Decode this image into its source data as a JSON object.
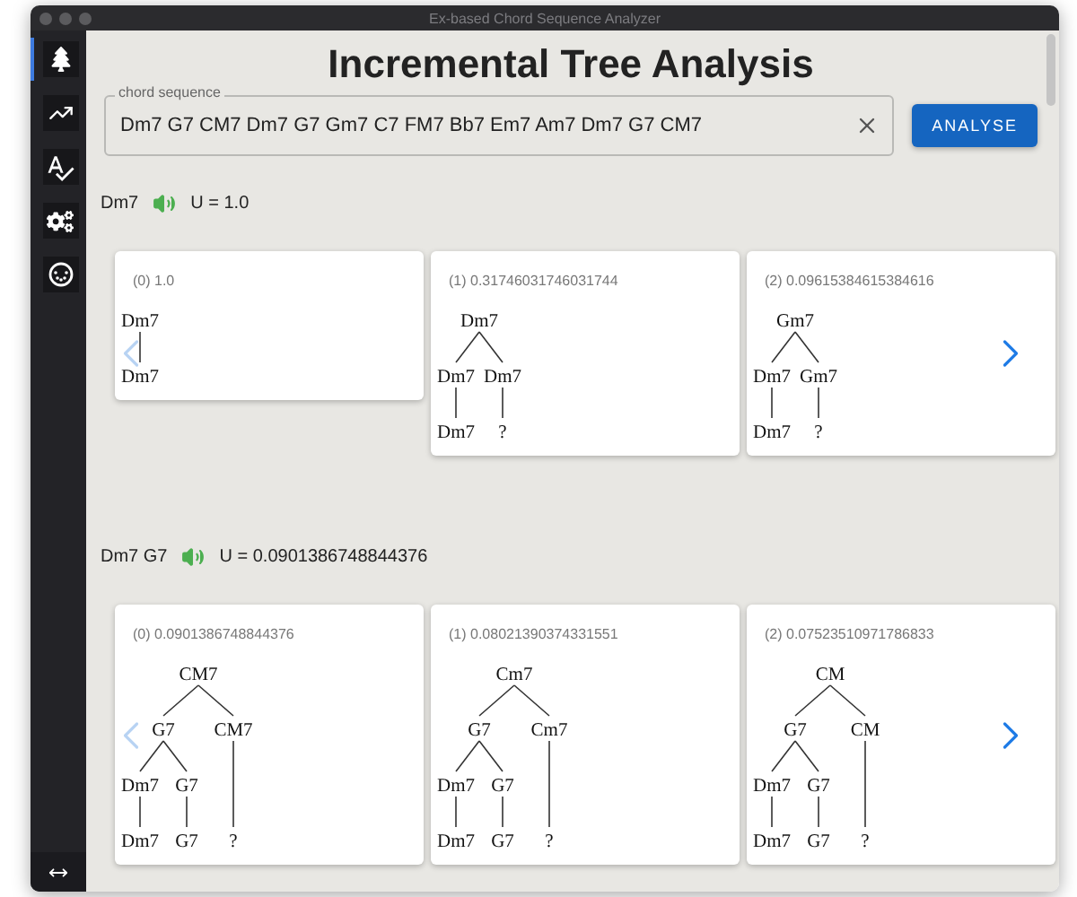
{
  "window": {
    "title": "Ex-based Chord Sequence Analyzer"
  },
  "sidebar": {
    "items": [
      {
        "kind": "tree",
        "selected": true
      },
      {
        "kind": "chart",
        "selected": false
      },
      {
        "kind": "spellcheck",
        "selected": false
      },
      {
        "kind": "gears",
        "selected": false
      },
      {
        "kind": "midi",
        "selected": false
      }
    ]
  },
  "heading": "Incremental Tree Analysis",
  "chord_field": {
    "label": "chord sequence",
    "value": "Dm7 G7 CM7 Dm7 G7 Gm7 C7 FM7 Bb7 Em7 Am7 Dm7 G7 CM7"
  },
  "analyse_button": "ANALYSE",
  "steps": [
    {
      "prefix": "Dm7",
      "utility": "U = 1.0",
      "cards": [
        {
          "caption": "(0) 1.0",
          "tree": {
            "label": "Dm7",
            "children": [
              {
                "label": "Dm7"
              }
            ]
          }
        },
        {
          "caption": "(1) 0.31746031746031744",
          "tree": {
            "label": "Dm7",
            "children": [
              {
                "label": "Dm7",
                "children": [
                  {
                    "label": "Dm7"
                  }
                ]
              },
              {
                "label": "Dm7",
                "children": [
                  {
                    "label": "?"
                  }
                ]
              }
            ]
          }
        },
        {
          "caption": "(2) 0.09615384615384616",
          "tree": {
            "label": "Gm7",
            "children": [
              {
                "label": "Dm7",
                "children": [
                  {
                    "label": "Dm7"
                  }
                ]
              },
              {
                "label": "Gm7",
                "children": [
                  {
                    "label": "?"
                  }
                ]
              }
            ]
          }
        }
      ]
    },
    {
      "prefix": "Dm7 G7",
      "utility": "U = 0.0901386748844376",
      "cards": [
        {
          "caption": "(0) 0.0901386748844376",
          "tree": {
            "label": "CM7",
            "children": [
              {
                "label": "G7",
                "children": [
                  {
                    "label": "Dm7",
                    "children": [
                      {
                        "label": "Dm7"
                      }
                    ]
                  },
                  {
                    "label": "G7",
                    "children": [
                      {
                        "label": "G7"
                      }
                    ]
                  }
                ]
              },
              {
                "label": "CM7",
                "children": [
                  {
                    "label": "?"
                  }
                ]
              }
            ]
          }
        },
        {
          "caption": "(1) 0.08021390374331551",
          "tree": {
            "label": "Cm7",
            "children": [
              {
                "label": "G7",
                "children": [
                  {
                    "label": "Dm7",
                    "children": [
                      {
                        "label": "Dm7"
                      }
                    ]
                  },
                  {
                    "label": "G7",
                    "children": [
                      {
                        "label": "G7"
                      }
                    ]
                  }
                ]
              },
              {
                "label": "Cm7",
                "children": [
                  {
                    "label": "?"
                  }
                ]
              }
            ]
          }
        },
        {
          "caption": "(2) 0.07523510971786833",
          "tree": {
            "label": "CM",
            "children": [
              {
                "label": "G7",
                "children": [
                  {
                    "label": "Dm7",
                    "children": [
                      {
                        "label": "Dm7"
                      }
                    ]
                  },
                  {
                    "label": "G7",
                    "children": [
                      {
                        "label": "G7"
                      }
                    ]
                  }
                ]
              },
              {
                "label": "CM",
                "children": [
                  {
                    "label": "?"
                  }
                ]
              }
            ]
          }
        }
      ]
    }
  ]
}
